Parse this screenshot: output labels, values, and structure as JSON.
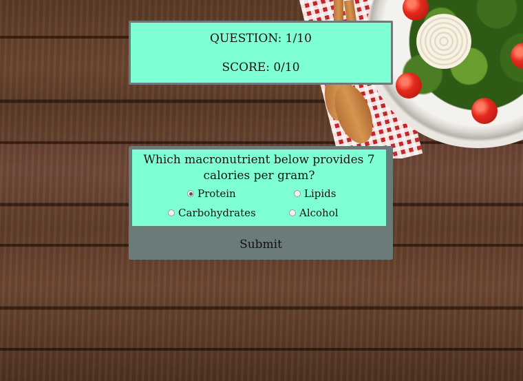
{
  "status": {
    "question_label": "QUESTION: 1/10",
    "score_label": "SCORE: 0/10"
  },
  "quiz": {
    "question": "Which macronutrient below provides 7 calories per gram?",
    "options": [
      {
        "label": "Protein",
        "checked": true
      },
      {
        "label": "Lipids",
        "checked": false
      },
      {
        "label": "Carbohydrates",
        "checked": false
      },
      {
        "label": "Alcohol",
        "checked": false
      }
    ],
    "submit_label": "Submit"
  },
  "colors": {
    "panel_bg": "#7fffd4",
    "panel_border": "#6a7b79",
    "button_bg": "#6b7b79"
  }
}
